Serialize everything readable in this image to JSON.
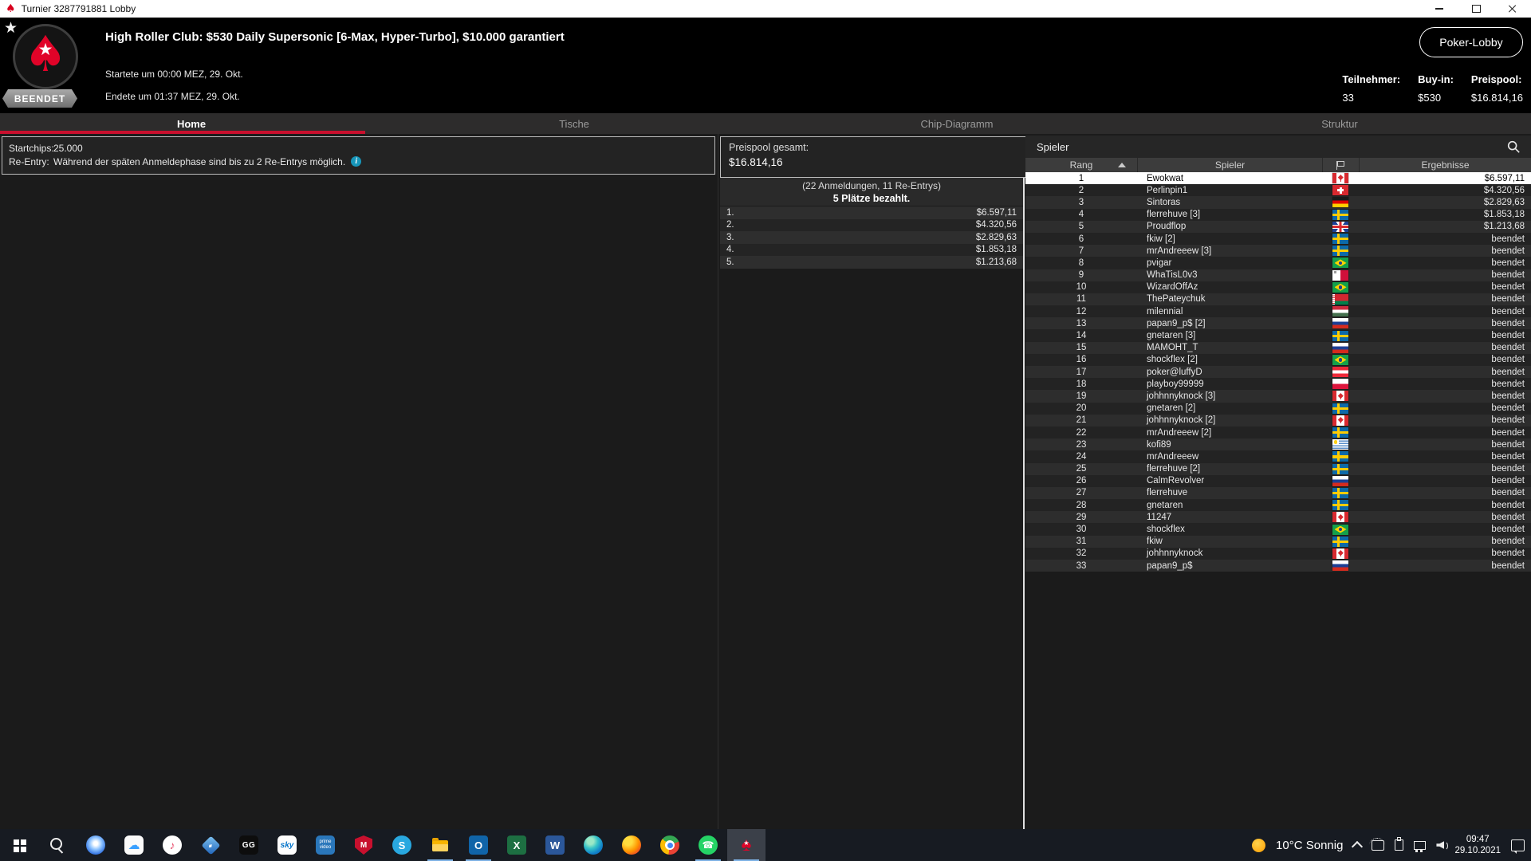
{
  "window": {
    "title": "Turnier 3287791881 Lobby",
    "app_icon": "pokerstars-spade-icon",
    "controls": [
      "minimize",
      "restore",
      "close"
    ]
  },
  "header": {
    "favorite_icon": "star-icon",
    "logo_icon": "pokerstars-logo",
    "status_badge": "BEENDET",
    "title": "High Roller Club: $530 Daily Supersonic [6-Max, Hyper-Turbo], $10.000 garantiert",
    "started": "Startete um 00:00 MEZ, 29. Okt.",
    "ended": "Endete um 01:37 MEZ, 29. Okt.",
    "lobby_button": "Poker-Lobby",
    "stats": [
      {
        "label": "Teilnehmer:",
        "value": "33"
      },
      {
        "label": "Buy-in:",
        "value": "$530"
      },
      {
        "label": "Preispool:",
        "value": "$16.814,16"
      }
    ]
  },
  "tabs": [
    {
      "label": "Home",
      "active": true
    },
    {
      "label": "Tische"
    },
    {
      "label": "Chip-Diagramm"
    },
    {
      "label": "Struktur"
    }
  ],
  "info": {
    "startchips_label": "Startchips:",
    "startchips_value": "25.000",
    "reentry_label": "Re-Entry:",
    "reentry_value": "Während der späten Anmeldephase sind bis zu 2 Re-Entrys möglich.",
    "info_icon": "info-circle-icon"
  },
  "prizepool": {
    "label": "Preispool gesamt:",
    "total": "$16.814,16",
    "registrations": "(22 Anmeldungen, 11 Re-Entrys)",
    "places_paid": "5 Plätze bezahlt.",
    "payouts": [
      {
        "place": "1.",
        "amount": "$6.597,11"
      },
      {
        "place": "2.",
        "amount": "$4.320,56"
      },
      {
        "place": "3.",
        "amount": "$2.829,63"
      },
      {
        "place": "4.",
        "amount": "$1.853,18"
      },
      {
        "place": "5.",
        "amount": "$1.213,68"
      }
    ]
  },
  "players": {
    "panel_title": "Spieler",
    "search_icon": "magnifier-icon",
    "columns": {
      "rank": "Rang",
      "player": "Spieler",
      "flag_icon": "flag-outline-icon",
      "results": "Ergebnisse"
    },
    "sort_icon": "caret-up-icon",
    "rows": [
      {
        "rank": "1",
        "player": "Ewokwat",
        "country": "canada",
        "result": "$6.597,11",
        "selected": true
      },
      {
        "rank": "2",
        "player": "Perlinpin1",
        "country": "switzerland",
        "result": "$4.320,56"
      },
      {
        "rank": "3",
        "player": "Sintoras",
        "country": "germany",
        "result": "$2.829,63"
      },
      {
        "rank": "4",
        "player": "flerrehuve [3]",
        "country": "sweden",
        "result": "$1.853,18"
      },
      {
        "rank": "5",
        "player": "Proudflop",
        "country": "uk",
        "result": "$1.213,68"
      },
      {
        "rank": "6",
        "player": "fkiw [2]",
        "country": "sweden",
        "result": "beendet"
      },
      {
        "rank": "7",
        "player": "mrAndreeew [3]",
        "country": "sweden",
        "result": "beendet"
      },
      {
        "rank": "8",
        "player": "pvigar",
        "country": "brazil",
        "result": "beendet"
      },
      {
        "rank": "9",
        "player": "WhaTisL0v3",
        "country": "malta",
        "result": "beendet"
      },
      {
        "rank": "10",
        "player": "WizardOffAz",
        "country": "brazil",
        "result": "beendet"
      },
      {
        "rank": "11",
        "player": "ThePateychuk",
        "country": "belarus",
        "result": "beendet"
      },
      {
        "rank": "12",
        "player": "milennial",
        "country": "hungary",
        "result": "beendet"
      },
      {
        "rank": "13",
        "player": "papan9_p$ [2]",
        "country": "russia",
        "result": "beendet"
      },
      {
        "rank": "14",
        "player": "gnetaren [3]",
        "country": "sweden",
        "result": "beendet"
      },
      {
        "rank": "15",
        "player": "MAMOHT_T",
        "country": "russia",
        "result": "beendet"
      },
      {
        "rank": "16",
        "player": "shockflex [2]",
        "country": "brazil",
        "result": "beendet"
      },
      {
        "rank": "17",
        "player": "poker@luffyD",
        "country": "austria",
        "result": "beendet"
      },
      {
        "rank": "18",
        "player": "playboy99999",
        "country": "poland",
        "result": "beendet"
      },
      {
        "rank": "19",
        "player": "johhnnyknock [3]",
        "country": "canada",
        "result": "beendet"
      },
      {
        "rank": "20",
        "player": "gnetaren [2]",
        "country": "sweden",
        "result": "beendet"
      },
      {
        "rank": "21",
        "player": "johhnnyknock [2]",
        "country": "canada",
        "result": "beendet"
      },
      {
        "rank": "22",
        "player": "mrAndreeew [2]",
        "country": "sweden",
        "result": "beendet"
      },
      {
        "rank": "23",
        "player": "kofi89",
        "country": "uruguay",
        "result": "beendet"
      },
      {
        "rank": "24",
        "player": "mrAndreeew",
        "country": "sweden",
        "result": "beendet"
      },
      {
        "rank": "25",
        "player": "flerrehuve [2]",
        "country": "sweden",
        "result": "beendet"
      },
      {
        "rank": "26",
        "player": "CalmRevolver",
        "country": "russia",
        "result": "beendet"
      },
      {
        "rank": "27",
        "player": "flerrehuve",
        "country": "sweden",
        "result": "beendet"
      },
      {
        "rank": "28",
        "player": "gnetaren",
        "country": "sweden",
        "result": "beendet"
      },
      {
        "rank": "29",
        "player": "11247",
        "country": "canada",
        "result": "beendet"
      },
      {
        "rank": "30",
        "player": "shockflex",
        "country": "brazil",
        "result": "beendet"
      },
      {
        "rank": "31",
        "player": "fkiw",
        "country": "sweden",
        "result": "beendet"
      },
      {
        "rank": "32",
        "player": "johhnnyknock",
        "country": "canada",
        "result": "beendet"
      },
      {
        "rank": "33",
        "player": "papan9_p$",
        "country": "russia",
        "result": "beendet"
      }
    ]
  },
  "taskbar": {
    "icons": [
      {
        "name": "start"
      },
      {
        "name": "search"
      },
      {
        "name": "signal"
      },
      {
        "name": "icloud",
        "glyph": "☁"
      },
      {
        "name": "itunes",
        "glyph": "♪"
      },
      {
        "name": "cards-app",
        "glyph": "♦"
      },
      {
        "name": "ggpoker",
        "glyph": "GG"
      },
      {
        "name": "sky",
        "glyph": "sky"
      },
      {
        "name": "prime-video",
        "glyph": "prime video"
      },
      {
        "name": "mcafee",
        "glyph": "M"
      },
      {
        "name": "skype",
        "glyph": "S"
      },
      {
        "name": "file-explorer",
        "open": true
      },
      {
        "name": "outlook",
        "glyph": "O",
        "open": true
      },
      {
        "name": "excel",
        "glyph": "X"
      },
      {
        "name": "word",
        "glyph": "W"
      },
      {
        "name": "edge"
      },
      {
        "name": "firefox"
      },
      {
        "name": "chrome"
      },
      {
        "name": "whatsapp",
        "glyph": "☎",
        "open": true
      },
      {
        "name": "pokerstars",
        "glyph": "♠",
        "active": true,
        "open": true
      }
    ],
    "weather": {
      "icon": "sun-icon",
      "text": "10°C  Sonnig"
    },
    "tray_icons": [
      "chevron-up-icon",
      "tablet-icon",
      "usb-icon",
      "ethernet-icon",
      "volume-icon"
    ],
    "clock": {
      "time": "09:47",
      "date": "29.10.2021"
    },
    "action_center_icon": "action-center-icon"
  },
  "colors": {
    "accent_red": "#c8102e",
    "spade_red": "#e00328",
    "selected_row_bg": "#ffffff",
    "panel_bg": "#232323",
    "taskbar_bg": "#171b22"
  }
}
